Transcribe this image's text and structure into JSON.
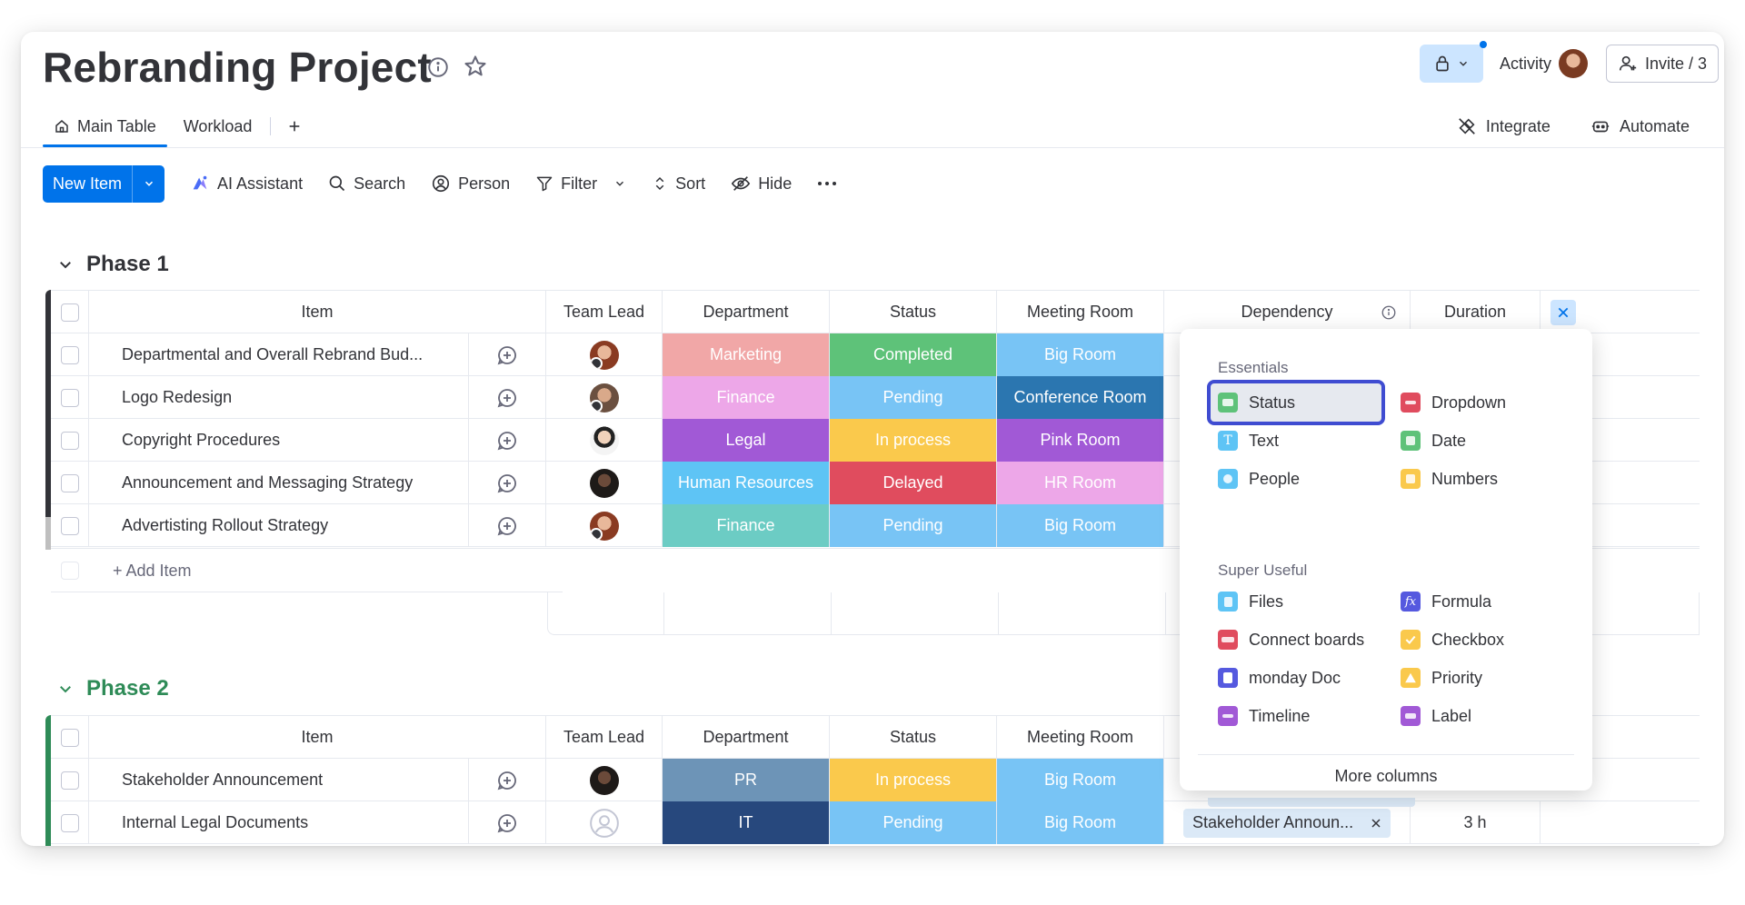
{
  "header": {
    "title": "Rebranding Project",
    "activity_label": "Activity",
    "invite_label": "Invite / 3"
  },
  "tabs": [
    {
      "label": "Main Table",
      "active": true
    },
    {
      "label": "Workload",
      "active": false
    }
  ],
  "top_links": {
    "integrate": "Integrate",
    "automate": "Automate"
  },
  "toolbar": {
    "new_item": "New Item",
    "ai_assistant": "AI Assistant",
    "search": "Search",
    "person": "Person",
    "filter": "Filter",
    "sort": "Sort",
    "hide": "Hide"
  },
  "columns": [
    "Item",
    "Team Lead",
    "Department",
    "Status",
    "Meeting Room",
    "Dependency",
    "Duration"
  ],
  "groups": [
    {
      "name": "Phase 1",
      "color": "#323338",
      "add_item": "+ Add Item",
      "rows": [
        {
          "item": "Departmental and Overall Rebrand Bud...",
          "department": "Marketing",
          "dept_color": "#f1a7a7",
          "status": "Completed",
          "status_color": "#5ec279",
          "room": "Big Room",
          "room_color": "#78c4f5"
        },
        {
          "item": "Logo Redesign",
          "department": "Finance",
          "dept_color": "#eda7e8",
          "status": "Pending",
          "status_color": "#78c4f5",
          "room": "Conference Room",
          "room_color": "#2b76b0"
        },
        {
          "item": "Copyright Procedures",
          "department": "Legal",
          "dept_color": "#a159d6",
          "status": "In process",
          "status_color": "#fac94c",
          "room": "Pink Room",
          "room_color": "#a159d6"
        },
        {
          "item": "Announcement and Messaging Strategy",
          "department": "Human Resources",
          "dept_color": "#5ec4f5",
          "status": "Delayed",
          "status_color": "#e04c5e",
          "room": "HR Room",
          "room_color": "#eda7e8"
        },
        {
          "item": "Advertisting Rollout Strategy",
          "department": "Finance",
          "dept_color": "#6cccc4",
          "status": "Pending",
          "status_color": "#78c4f5",
          "room": "Big Room",
          "room_color": "#78c4f5"
        }
      ]
    },
    {
      "name": "Phase 2",
      "color": "#2e8b57",
      "rows": [
        {
          "item": "Stakeholder Announcement",
          "department": "PR",
          "dept_color": "#6d94b7",
          "status": "In process",
          "status_color": "#fac94c",
          "room": "Big Room",
          "room_color": "#78c4f5"
        },
        {
          "item": "Internal Legal Documents",
          "department": "IT",
          "dept_color": "#27487d",
          "status": "Pending",
          "status_color": "#78c4f5",
          "room": "Big Room",
          "room_color": "#78c4f5",
          "dependency": "Stakeholder Announ...",
          "duration": "3 h"
        }
      ]
    }
  ],
  "column_picker": {
    "essentials_label": "Essentials",
    "super_useful_label": "Super Useful",
    "more_columns": "More columns",
    "essentials": [
      {
        "label": "Status",
        "icon": "status-icon",
        "color": "#5ec279"
      },
      {
        "label": "Dropdown",
        "icon": "dropdown-icon",
        "color": "#e04c5e"
      },
      {
        "label": "Text",
        "icon": "text-icon",
        "color": "#5ec4f5"
      },
      {
        "label": "Date",
        "icon": "date-icon",
        "color": "#5ec279"
      },
      {
        "label": "People",
        "icon": "people-icon",
        "color": "#5ec4f5"
      },
      {
        "label": "Numbers",
        "icon": "numbers-icon",
        "color": "#fac94c"
      }
    ],
    "super_useful": [
      {
        "label": "Files",
        "icon": "files-icon",
        "color": "#5ec4f5"
      },
      {
        "label": "Formula",
        "icon": "formula-icon",
        "color": "#5559df"
      },
      {
        "label": "Connect boards",
        "icon": "connect-boards-icon",
        "color": "#e04c5e"
      },
      {
        "label": "Checkbox",
        "icon": "checkbox-icon",
        "color": "#fac94c"
      },
      {
        "label": "monday Doc",
        "icon": "monday-doc-icon",
        "color": "#5559df"
      },
      {
        "label": "Priority",
        "icon": "priority-icon",
        "color": "#fac94c"
      },
      {
        "label": "Timeline",
        "icon": "timeline-icon",
        "color": "#a159d6"
      },
      {
        "label": "Label",
        "icon": "label-icon",
        "color": "#a159d6"
      }
    ]
  }
}
